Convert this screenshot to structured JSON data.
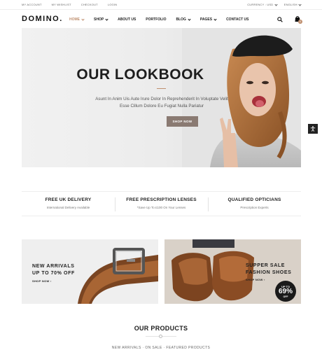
{
  "topbar": {
    "links": [
      "MY ACCOUNT",
      "MY WISHLIST",
      "CHECKOUT",
      "LOGIN"
    ],
    "currency": "CURRENCY : USD",
    "language": "ENGLISH"
  },
  "header": {
    "logo": "DOMINO.",
    "nav": [
      {
        "label": "HOME",
        "dropdown": true
      },
      {
        "label": "SHOP",
        "dropdown": true
      },
      {
        "label": "ABOUT US",
        "dropdown": false
      },
      {
        "label": "PORTFOLIO",
        "dropdown": false
      },
      {
        "label": "BLOG",
        "dropdown": true
      },
      {
        "label": "PAGES",
        "dropdown": true
      },
      {
        "label": "CONTACT US",
        "dropdown": false
      }
    ],
    "cart_count": "0"
  },
  "hero": {
    "title": "OUR LOOKBOOK",
    "subtitle_line1": "Asunt In Anim Uis Aute Irure Dolor In Reprehenderit In Voluptate Velit",
    "subtitle_line2": "Esse Cillum Dolore Eu Fugiat Nulla Pariatur",
    "button": "SHOP NOW"
  },
  "features": [
    {
      "title": "FREE UK DELIVERY",
      "subtitle": "International Delivery Available"
    },
    {
      "title": "FREE PRESCRIPTION LENSES",
      "subtitle": "*Save Up To £100 On Your Lenses"
    },
    {
      "title": "QUALIFIED OPTICIANS",
      "subtitle": "Prescription Experts"
    }
  ],
  "banners": {
    "left": {
      "line1": "NEW ARRIVALS",
      "line2": "UP TO 70% OFF",
      "link": "SHOP NOW"
    },
    "right": {
      "line1": "SUPPER SALE",
      "line2": "FASHION SHOES",
      "link": "SHOP NOW"
    },
    "badge": {
      "l1": "UP TO",
      "l2": "69%",
      "l3": "OFF"
    }
  },
  "products": {
    "title": "OUR PRODUCTS",
    "tabs": "NEW ARRIVALS   ·   ON SALE   ·   FEATURED PRODUCTS"
  },
  "colors": {
    "accent": "#bf8f6f",
    "dark": "#1d1d1d"
  }
}
